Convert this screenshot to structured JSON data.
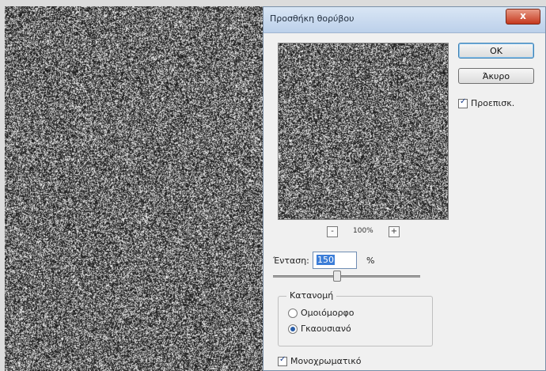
{
  "dialog": {
    "title": "Προσθήκη θορύβου",
    "close_label": "x",
    "ok_label": "OK",
    "cancel_label": "Άκυρο",
    "preview_label": "Προεπισκ.",
    "preview_checked": true,
    "zoom_out_label": "-",
    "zoom_in_label": "+",
    "zoom_level": "100%",
    "intensity_label": "Ένταση:",
    "intensity_value": "150",
    "intensity_unit": "%",
    "distribution": {
      "legend": "Κατανομή",
      "options": [
        {
          "label": "Ομοιόμορφο",
          "selected": false
        },
        {
          "label": "Γκαουσιανό",
          "selected": true
        }
      ]
    },
    "monochrome_label": "Μονοχρωματικό",
    "monochrome_checked": true
  },
  "colors": {
    "noise_dark": "#1a1a1a",
    "noise_light": "#ffffff",
    "accent": "#3b7dd8"
  }
}
